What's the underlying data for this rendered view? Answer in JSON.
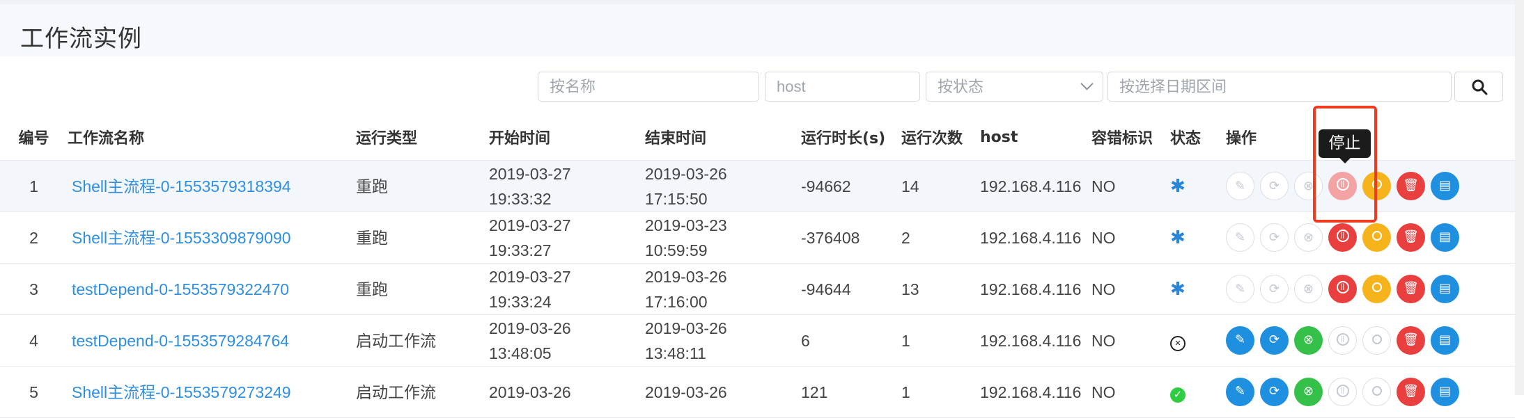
{
  "header": {
    "title": "工作流实例"
  },
  "filters": {
    "name_placeholder": "按名称",
    "host_placeholder": "host",
    "status_placeholder": "按状态",
    "date_placeholder": "按选择日期区间"
  },
  "table": {
    "columns": [
      "编号",
      "工作流名称",
      "运行类型",
      "开始时间",
      "结束时间",
      "运行时长(s)",
      "运行次数",
      "host",
      "容错标识",
      "状态",
      "操作"
    ],
    "rows": [
      {
        "id": "1",
        "name": "Shell主流程-0-1553579318394",
        "run_type": "重跑",
        "start_date": "2019-03-27",
        "start_time": "19:33:32",
        "end_date": "2019-03-26",
        "end_time": "17:15:50",
        "duration": "-94662",
        "runs": "14",
        "host": "192.168.4.116",
        "fault": "NO",
        "state_icon": "gear-icon"
      },
      {
        "id": "2",
        "name": "Shell主流程-0-1553309879090",
        "run_type": "重跑",
        "start_date": "2019-03-27",
        "start_time": "19:33:27",
        "end_date": "2019-03-23",
        "end_time": "10:59:59",
        "duration": "-376408",
        "runs": "2",
        "host": "192.168.4.116",
        "fault": "NO",
        "state_icon": "gear-icon"
      },
      {
        "id": "3",
        "name": "testDepend-0-1553579322470",
        "run_type": "重跑",
        "start_date": "2019-03-27",
        "start_time": "19:33:24",
        "end_date": "2019-03-26",
        "end_time": "17:16:00",
        "duration": "-94644",
        "runs": "13",
        "host": "192.168.4.116",
        "fault": "NO",
        "state_icon": "gear-icon"
      },
      {
        "id": "4",
        "name": "testDepend-0-1553579284764",
        "run_type": "启动工作流",
        "start_date": "2019-03-26",
        "start_time": "13:48:05",
        "end_date": "2019-03-26",
        "end_time": "13:48:11",
        "duration": "6",
        "runs": "1",
        "host": "192.168.4.116",
        "fault": "NO",
        "state_icon": "x-circle-icon"
      },
      {
        "id": "5",
        "name": "Shell主流程-0-1553579273249",
        "run_type": "启动工作流",
        "start_date": "2019-03-26",
        "start_time": "",
        "end_date": "2019-03-26",
        "end_time": "",
        "duration": "121",
        "runs": "1",
        "host": "192.168.4.116",
        "fault": "NO",
        "state_icon": "check-circle-icon"
      }
    ]
  },
  "tooltip": {
    "text": "停止"
  },
  "colors": {
    "link": "#2f8fe0",
    "primary": "#1f8fe0",
    "danger": "#ea3f3f",
    "warning": "#f7b31b",
    "success": "#35c04a",
    "highlight": "#ef3b1f"
  }
}
